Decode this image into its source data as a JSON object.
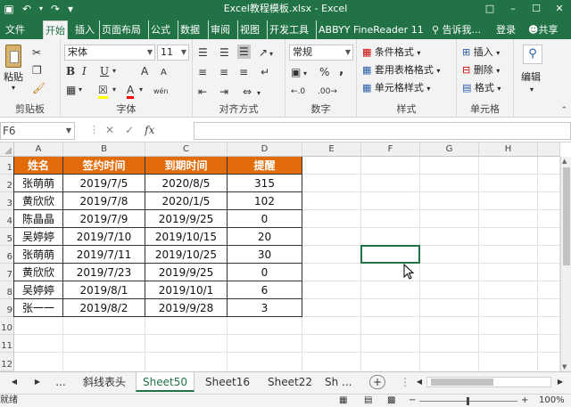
{
  "window": {
    "title": "Excel教程模板.xlsx - Excel"
  },
  "ribbon_tabs": [
    "文件",
    "开始",
    "插入",
    "页面布局",
    "公式",
    "数据",
    "审阅",
    "视图",
    "开发工具",
    "ABBYY FineReader 11"
  ],
  "tell_me": "告诉我...",
  "sign_in": "登录",
  "share": "共享",
  "clipboard": {
    "paste": "粘贴",
    "label": "剪贴板"
  },
  "font": {
    "name": "宋体",
    "size": "11",
    "label": "字体",
    "bold": "B",
    "italic": "I",
    "underline": "U",
    "grow": "A",
    "shrink": "A",
    "color_a": "A",
    "wen": "wén"
  },
  "alignment": {
    "label": "对齐方式"
  },
  "number": {
    "format": "常规",
    "label": "数字",
    "percent": "%",
    "comma": ","
  },
  "styles": {
    "conditional": "条件格式",
    "table": "套用表格格式",
    "cell": "单元格样式",
    "label": "样式"
  },
  "cells": {
    "insert": "插入",
    "delete": "删除",
    "format": "格式",
    "label": "单元格"
  },
  "editing": {
    "label": "编辑"
  },
  "formula_bar": {
    "name_box": "F6",
    "fx": "fx",
    "cancel": "✕",
    "enter": "✓",
    "content": ""
  },
  "columns": [
    "A",
    "B",
    "C",
    "D",
    "E",
    "F",
    "G",
    "H"
  ],
  "rows": [
    "1",
    "2",
    "3",
    "4",
    "5",
    "6",
    "7",
    "8",
    "9",
    "10",
    "11",
    "12"
  ],
  "table": {
    "headers": [
      "姓名",
      "签约时间",
      "到期时间",
      "提醒"
    ],
    "rows": [
      [
        "张萌萌",
        "2019/7/5",
        "2020/8/5",
        "315"
      ],
      [
        "黄欣欣",
        "2019/7/8",
        "2020/1/5",
        "102"
      ],
      [
        "陈晶晶",
        "2019/7/9",
        "2019/9/25",
        "0"
      ],
      [
        "吴婷婷",
        "2019/7/10",
        "2019/10/15",
        "20"
      ],
      [
        "张萌萌",
        "2019/7/11",
        "2019/10/25",
        "30"
      ],
      [
        "黄欣欣",
        "2019/7/23",
        "2019/9/25",
        "0"
      ],
      [
        "吴婷婷",
        "2019/8/1",
        "2019/10/1",
        "6"
      ],
      [
        "张一一",
        "2019/8/2",
        "2019/9/28",
        "3"
      ]
    ],
    "header_color": "#E26B0A"
  },
  "sheet_tabs": [
    "斜线表头",
    "Sheet50",
    "Sheet16",
    "Sheet22",
    "Sh ..."
  ],
  "active_sheet": "Sheet50",
  "nav": {
    "prev": "◀",
    "next": "▶",
    "more": "..."
  },
  "add_sheet": "+",
  "status": {
    "mode": "就绪",
    "zoom": "100%",
    "minus": "−",
    "plus": "+"
  },
  "accent": "#217346"
}
